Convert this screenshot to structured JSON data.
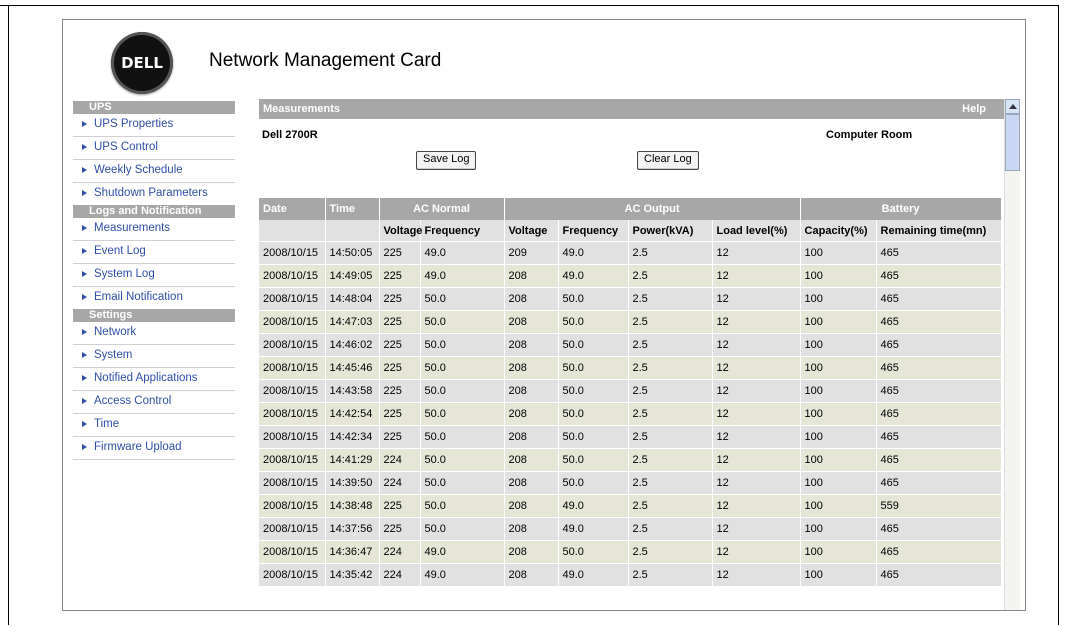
{
  "header": {
    "logo_text": "DELL",
    "title": "Network Management Card"
  },
  "sidebar": {
    "sections": [
      {
        "title": "UPS",
        "items": [
          "UPS Properties",
          "UPS Control",
          "Weekly Schedule",
          "Shutdown Parameters"
        ]
      },
      {
        "title": "Logs and Notification",
        "items": [
          "Measurements",
          "Event Log",
          "System Log",
          "Email Notification"
        ]
      },
      {
        "title": "Settings",
        "items": [
          "Network",
          "System",
          "Notified Applications",
          "Access Control",
          "Time",
          "Firmware Upload"
        ]
      }
    ]
  },
  "main": {
    "section_title": "Measurements",
    "help_label": "Help",
    "device_name": "Dell 2700R",
    "location": "Computer Room",
    "save_log_label": "Save Log",
    "clear_log_label": "Clear Log",
    "group_headers": {
      "date": "Date",
      "time": "Time",
      "ac_normal": "AC Normal",
      "ac_output": "AC Output",
      "battery": "Battery"
    },
    "sub_headers": [
      "Voltage",
      "Frequency",
      "Voltage",
      "Frequency",
      "Power(kVA)",
      "Load level(%)",
      "Capacity(%)",
      "Remaining time(mn)"
    ],
    "rows": [
      [
        "2008/10/15",
        "14:50:05",
        "225",
        "49.0",
        "209",
        "49.0",
        "2.5",
        "12",
        "100",
        "465"
      ],
      [
        "2008/10/15",
        "14:49:05",
        "225",
        "49.0",
        "208",
        "49.0",
        "2.5",
        "12",
        "100",
        "465"
      ],
      [
        "2008/10/15",
        "14:48:04",
        "225",
        "50.0",
        "208",
        "50.0",
        "2.5",
        "12",
        "100",
        "465"
      ],
      [
        "2008/10/15",
        "14:47:03",
        "225",
        "50.0",
        "208",
        "50.0",
        "2.5",
        "12",
        "100",
        "465"
      ],
      [
        "2008/10/15",
        "14:46:02",
        "225",
        "50.0",
        "208",
        "50.0",
        "2.5",
        "12",
        "100",
        "465"
      ],
      [
        "2008/10/15",
        "14:45:46",
        "225",
        "50.0",
        "208",
        "50.0",
        "2.5",
        "12",
        "100",
        "465"
      ],
      [
        "2008/10/15",
        "14:43:58",
        "225",
        "50.0",
        "208",
        "50.0",
        "2.5",
        "12",
        "100",
        "465"
      ],
      [
        "2008/10/15",
        "14:42:54",
        "225",
        "50.0",
        "208",
        "50.0",
        "2.5",
        "12",
        "100",
        "465"
      ],
      [
        "2008/10/15",
        "14:42:34",
        "225",
        "50.0",
        "208",
        "50.0",
        "2.5",
        "12",
        "100",
        "465"
      ],
      [
        "2008/10/15",
        "14:41:29",
        "224",
        "50.0",
        "208",
        "50.0",
        "2.5",
        "12",
        "100",
        "465"
      ],
      [
        "2008/10/15",
        "14:39:50",
        "224",
        "50.0",
        "208",
        "50.0",
        "2.5",
        "12",
        "100",
        "465"
      ],
      [
        "2008/10/15",
        "14:38:48",
        "225",
        "50.0",
        "208",
        "49.0",
        "2.5",
        "12",
        "100",
        "559"
      ],
      [
        "2008/10/15",
        "14:37:56",
        "225",
        "50.0",
        "208",
        "49.0",
        "2.5",
        "12",
        "100",
        "465"
      ],
      [
        "2008/10/15",
        "14:36:47",
        "224",
        "49.0",
        "208",
        "50.0",
        "2.5",
        "12",
        "100",
        "465"
      ],
      [
        "2008/10/15",
        "14:35:42",
        "224",
        "49.0",
        "208",
        "49.0",
        "2.5",
        "12",
        "100",
        "465"
      ]
    ]
  },
  "colors": {
    "header_gray": "#a7a7a7",
    "link_blue": "#2f4fa8",
    "row_gray": "#e1e1e1",
    "row_olive": "#e5e6d6"
  }
}
